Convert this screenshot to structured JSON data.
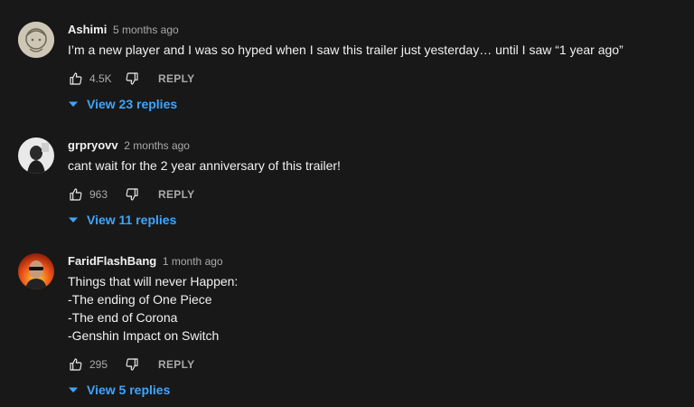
{
  "comments": [
    {
      "author": "Ashimi",
      "time": "5 months ago",
      "lines": [
        "I’m a new player and I was so hyped when I saw this trailer just yesterday… until I saw “1 year ago”"
      ],
      "likes": "4.5K",
      "reply_label": "REPLY",
      "view_replies": "View 23 replies"
    },
    {
      "author": "grpryovv",
      "time": "2 months ago",
      "lines": [
        "cant wait for the 2 year anniversary of this trailer!"
      ],
      "likes": "963",
      "reply_label": "REPLY",
      "view_replies": "View 11 replies"
    },
    {
      "author": "FaridFlashBang",
      "time": "1 month ago",
      "lines": [
        "Things that will never Happen:",
        "-The ending of One Piece",
        "-The end of Corona",
        "-Genshin Impact on Switch"
      ],
      "likes": "295",
      "reply_label": "REPLY",
      "view_replies": "View 5 replies"
    }
  ],
  "colors": {
    "background": "#181818",
    "link": "#3ea6ff",
    "muted": "#aaaaaa"
  },
  "icons": {
    "like": "thumb-up-icon",
    "dislike": "thumb-down-icon",
    "expand": "caret-down-icon"
  }
}
